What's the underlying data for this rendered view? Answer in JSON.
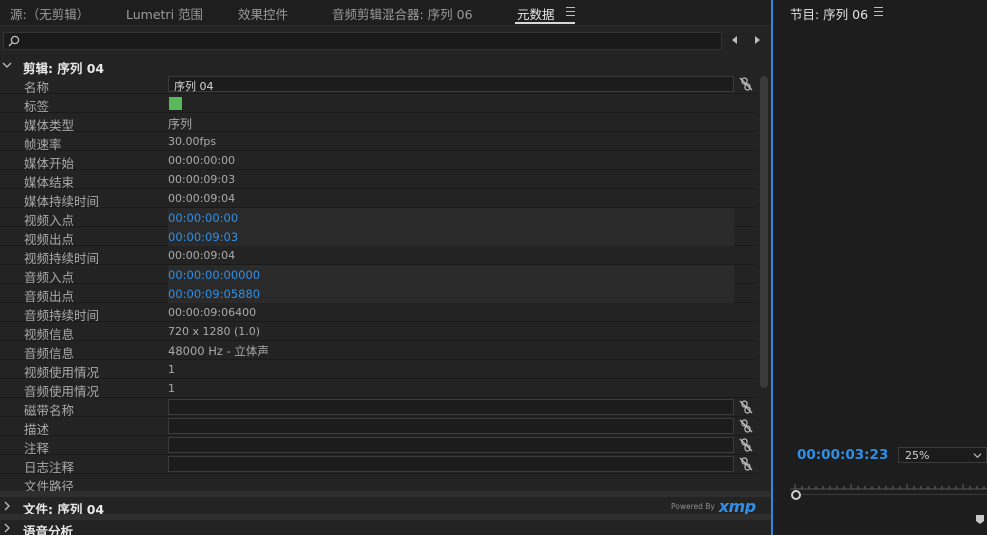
{
  "tabs": [
    {
      "label": "源:（无剪辑）"
    },
    {
      "label": "Lumetri 范围"
    },
    {
      "label": "效果控件"
    },
    {
      "label": "音频剪辑混合器: 序列 06"
    },
    {
      "label": "元数据"
    }
  ],
  "search": {
    "placeholder": ""
  },
  "clip_section": {
    "label": "剪辑: 序列 04"
  },
  "rows": [
    {
      "key": "名称",
      "value": "序列 04",
      "kind": "field"
    },
    {
      "key": "标签",
      "value": "",
      "kind": "swatch",
      "color": "#59b85a"
    },
    {
      "key": "媒体类型",
      "value": "序列",
      "kind": "text"
    },
    {
      "key": "帧速率",
      "value": "30.00fps",
      "kind": "text"
    },
    {
      "key": "媒体开始",
      "value": "00:00:00:00",
      "kind": "text"
    },
    {
      "key": "媒体结束",
      "value": "00:00:09:03",
      "kind": "text"
    },
    {
      "key": "媒体持续时间",
      "value": "00:00:09:04",
      "kind": "text"
    },
    {
      "key": "视频入点",
      "value": "00:00:00:00",
      "kind": "link"
    },
    {
      "key": "视频出点",
      "value": "00:00:09:03",
      "kind": "link"
    },
    {
      "key": "视频持续时间",
      "value": "00:00:09:04",
      "kind": "text"
    },
    {
      "key": "音频入点",
      "value": "00:00:00:00000",
      "kind": "link"
    },
    {
      "key": "音频出点",
      "value": "00:00:09:05880",
      "kind": "link"
    },
    {
      "key": "音频持续时间",
      "value": "00:00:09:06400",
      "kind": "text"
    },
    {
      "key": "视频信息",
      "value": "720 x 1280 (1.0)",
      "kind": "text"
    },
    {
      "key": "音频信息",
      "value": "48000 Hz - 立体声",
      "kind": "text"
    },
    {
      "key": "视频使用情况",
      "value": "1",
      "kind": "text"
    },
    {
      "key": "音频使用情况",
      "value": "1",
      "kind": "text"
    },
    {
      "key": "磁带名称",
      "value": "",
      "kind": "field"
    },
    {
      "key": "描述",
      "value": "",
      "kind": "field"
    },
    {
      "key": "注释",
      "value": "",
      "kind": "field"
    },
    {
      "key": "日志注释",
      "value": "",
      "kind": "field"
    },
    {
      "key": "文件路径",
      "value": "",
      "kind": "text"
    }
  ],
  "file_section": {
    "label": "文件: 序列 04"
  },
  "speech_section": {
    "label": "语音分析"
  },
  "xmp": {
    "powered_by": "Powered By",
    "brand": "xmp"
  },
  "program": {
    "title": "节目: 序列 06",
    "timecode": "00:00:03:23",
    "zoom": "25%"
  },
  "colors": {
    "accent": "#2f8fe6",
    "label_green": "#59b85a",
    "panel_divider": "#2d86e8"
  }
}
